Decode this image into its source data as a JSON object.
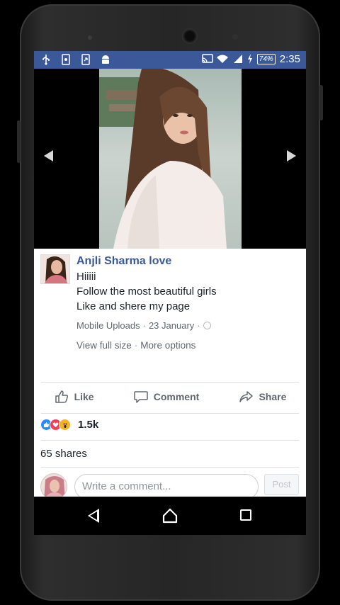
{
  "status_bar": {
    "battery": "74%",
    "time": "2:35",
    "left_icons": [
      "usb-icon",
      "sd-card-icon",
      "download-icon",
      "android-icon"
    ],
    "right_icons": [
      "cast-icon",
      "wifi-icon",
      "signal-icon",
      "charging-icon"
    ]
  },
  "viewer": {
    "prev_icon": "chevron-left-icon",
    "next_icon": "chevron-right-icon"
  },
  "post": {
    "author": "Anjli Sharma love",
    "text_lines": [
      "Hiiiii",
      "Follow the most beautiful girls",
      "Like and shere my page"
    ],
    "album": "Mobile Uploads",
    "separator": "·",
    "date": "23 January",
    "view_full_size": "View full size",
    "more_options": "More options"
  },
  "actions": {
    "like": "Like",
    "comment": "Comment",
    "share": "Share"
  },
  "reactions": {
    "count": "1.5k",
    "types": [
      "like",
      "love",
      "wow"
    ]
  },
  "shares": "65 shares",
  "comment_box": {
    "placeholder": "Write a comment...",
    "post_label": "Post"
  },
  "colors": {
    "brand": "#3b5998",
    "text": "#1d2129",
    "meta": "#616770"
  }
}
